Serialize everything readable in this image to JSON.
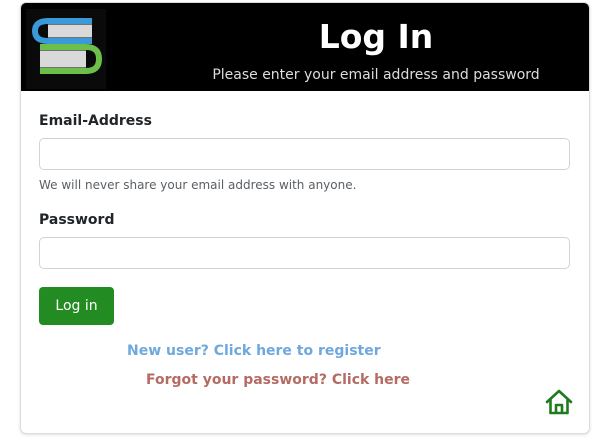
{
  "header": {
    "title": "Log In",
    "subtitle": "Please enter your email address and password"
  },
  "form": {
    "email_label": "Email-Address",
    "email_value": "",
    "email_placeholder": "",
    "email_help": "We will never share your email address with anyone.",
    "password_label": "Password",
    "password_value": "",
    "password_placeholder": "",
    "submit_label": "Log in"
  },
  "links": {
    "register": "New user? Click here to register",
    "forgot": "Forgot your password? Click here"
  },
  "icons": {
    "logo": "book-stack-icon",
    "home": "home-icon"
  },
  "colors": {
    "header_bg": "#000000",
    "primary_button": "#228b22",
    "register_link": "#6fa8dc",
    "forgot_link": "#b56b63",
    "home_icon": "#1e7b1e",
    "logo_blue": "#3a9ad9",
    "logo_green": "#6cc04a"
  }
}
